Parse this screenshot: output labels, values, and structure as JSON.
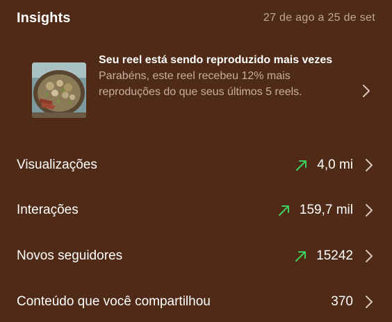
{
  "header": {
    "title": "Insights",
    "date_range": "27 de ago a 25 de set"
  },
  "highlight": {
    "title": "Seu reel está sendo reproduzido mais vezes",
    "description": "Parabéns, este reel recebeu 12% mais reproduções do que seus últimos 5 reels.",
    "thumbnail_icon": "food-plate-thumbnail",
    "chevron_icon": "chevron-right-icon"
  },
  "metrics": [
    {
      "label": "Visualizações",
      "value": "4,0 mi",
      "trend": "up"
    },
    {
      "label": "Interações",
      "value": "159,7 mil",
      "trend": "up"
    },
    {
      "label": "Novos seguidores",
      "value": "15242",
      "trend": "up"
    },
    {
      "label": "Conteúdo que você compartilhou",
      "value": "370",
      "trend": "none"
    }
  ],
  "colors": {
    "background": "#4f2a16",
    "trend_up": "#3fd15f",
    "muted_text": "#c7b0a0"
  }
}
